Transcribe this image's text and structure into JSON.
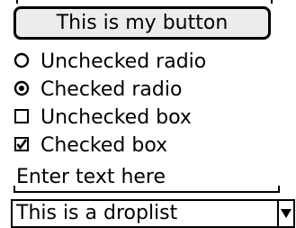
{
  "button": {
    "label": "This is my button"
  },
  "radios": [
    {
      "label": "Unchecked radio",
      "checked": false
    },
    {
      "label": "Checked radio",
      "checked": true
    }
  ],
  "checkboxes": [
    {
      "label": "Unchecked box",
      "checked": false
    },
    {
      "label": "Checked box",
      "checked": true
    }
  ],
  "textfield": {
    "value": "Enter text here"
  },
  "droplist": {
    "selected": "This is a droplist"
  }
}
